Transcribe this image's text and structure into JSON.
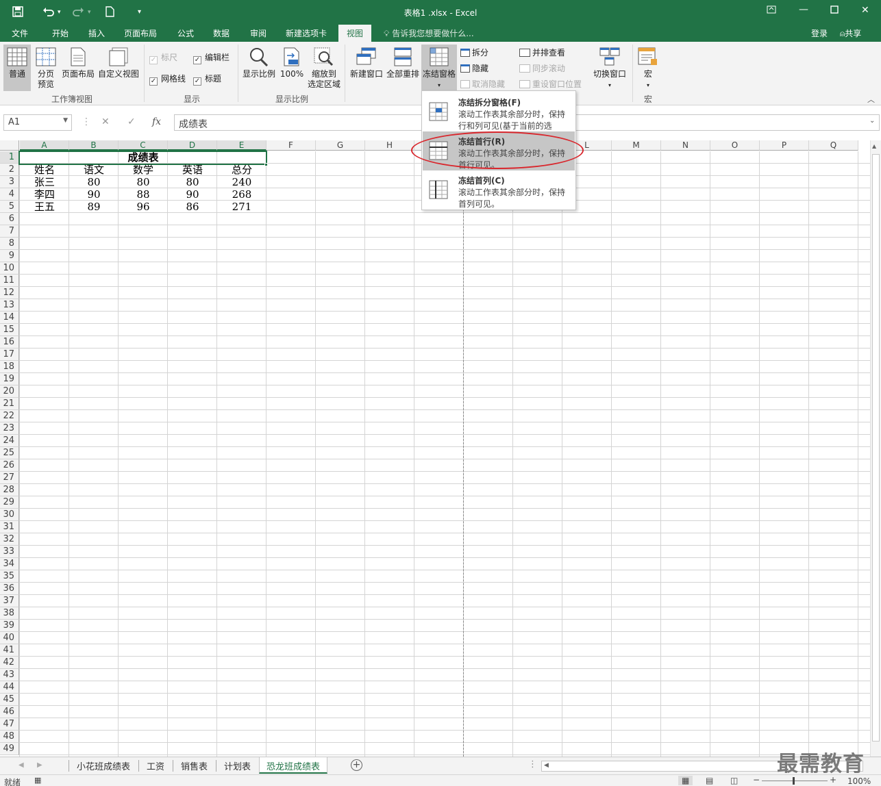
{
  "app": {
    "title": "表格1 .xlsx - Excel",
    "accent": "#217346"
  },
  "quick_access": {
    "save_icon": "save-icon",
    "undo_icon": "undo-icon",
    "redo_icon": "redo-icon",
    "new_icon": "new-document-icon",
    "customize_icon": "customize-icon"
  },
  "tabs": [
    {
      "label": "文件"
    },
    {
      "label": "开始"
    },
    {
      "label": "插入"
    },
    {
      "label": "页面布局"
    },
    {
      "label": "公式"
    },
    {
      "label": "数据"
    },
    {
      "label": "审阅"
    },
    {
      "label": "新建选项卡"
    },
    {
      "label": "视图",
      "active": true
    }
  ],
  "tell_me": "告诉我您想要做什么...",
  "login": "登录",
  "share": "共享",
  "ribbon": {
    "views": {
      "normal": "普通",
      "page_break": "分页",
      "page_break2": "预览",
      "page_layout": "页面布局",
      "custom": "自定义视图",
      "group": "工作簿视图"
    },
    "show": {
      "ruler": "标尺",
      "formula_bar": "编辑栏",
      "gridlines": "网格线",
      "headings": "标题",
      "group": "显示"
    },
    "zoom": {
      "zoom": "显示比例",
      "hundred": "100%",
      "to_sel1": "缩放到",
      "to_sel2": "选定区域",
      "group": "显示比例"
    },
    "window": {
      "new_window": "新建窗口",
      "arrange_all": "全部重排",
      "freeze": "冻结窗格",
      "split": "拆分",
      "hide": "隐藏",
      "unhide": "取消隐藏",
      "side_by_side": "并排查看",
      "sync_scroll": "同步滚动",
      "reset_pos": "重设窗口位置",
      "switch": "切换窗口"
    },
    "macros": {
      "macros": "宏",
      "group": "宏"
    }
  },
  "freeze_menu": {
    "items": [
      {
        "title": "冻结拆分窗格(F)",
        "desc": "滚动工作表其余部分时，保持行和列可见(基于当前的选择)。"
      },
      {
        "title": "冻结首行(R)",
        "desc": "滚动工作表其余部分时，保持首行可见。",
        "highlighted": true
      },
      {
        "title": "冻结首列(C)",
        "desc": "滚动工作表其余部分时，保持首列可见。"
      }
    ]
  },
  "formula_bar": {
    "name_box": "A1",
    "content": "成绩表",
    "cancel": "✕",
    "enter": "✓",
    "fx": "fx"
  },
  "columns": [
    "A",
    "B",
    "C",
    "D",
    "E",
    "F",
    "G",
    "H",
    "I",
    "J",
    "K",
    "L",
    "M",
    "N",
    "O",
    "P",
    "Q"
  ],
  "rows": [
    "1",
    "2",
    "3",
    "4",
    "5",
    "6",
    "7",
    "8",
    "9",
    "10",
    "11",
    "12",
    "13",
    "14",
    "15",
    "16",
    "17",
    "18",
    "19",
    "20",
    "21",
    "22",
    "23",
    "24",
    "25",
    "26",
    "27",
    "28",
    "29",
    "30",
    "31",
    "32",
    "33",
    "34",
    "35",
    "36",
    "37",
    "38",
    "39",
    "40",
    "41",
    "42",
    "43",
    "44",
    "45",
    "46",
    "47",
    "48",
    "49"
  ],
  "sheet": {
    "title": "成绩表",
    "headers": [
      "姓名",
      "语文",
      "数学",
      "英语",
      "总分"
    ],
    "data": [
      [
        "张三",
        "80",
        "80",
        "80",
        "240"
      ],
      [
        "李四",
        "90",
        "88",
        "90",
        "268"
      ],
      [
        "王五",
        "89",
        "96",
        "86",
        "271"
      ]
    ]
  },
  "sheet_tabs": [
    {
      "label": "小花班成绩表"
    },
    {
      "label": "工资"
    },
    {
      "label": "销售表"
    },
    {
      "label": "计划表"
    },
    {
      "label": "恐龙班成绩表",
      "active": true
    }
  ],
  "status": {
    "ready": "就绪",
    "zoom": "100%"
  },
  "watermark": "最需教育"
}
